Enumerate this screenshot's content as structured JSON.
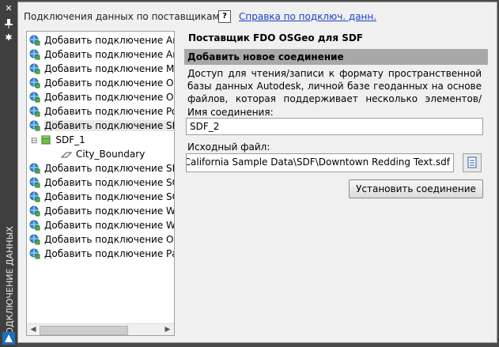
{
  "palette": {
    "vertical_title": "ПОДКЛЮЧЕНИЕ ДАННЫХ",
    "close_icon": "close-icon",
    "pin_icon": "pin-icon",
    "settings_icon": "gear-icon"
  },
  "header": {
    "title": "Подключения данных по поставщикам",
    "help_link": "Справка по подключ. данн."
  },
  "tree": {
    "items": [
      {
        "label": "Добавить подключение ArcGIS",
        "icon": "globe-connection-icon"
      },
      {
        "label": "Добавить подключение ArcSDE",
        "icon": "globe-connection-icon"
      },
      {
        "label": "Добавить подключение MySQL",
        "icon": "globe-connection-icon"
      },
      {
        "label": "Добавить подключение ODBC",
        "icon": "globe-connection-icon"
      },
      {
        "label": "Добавить подключение Oracle",
        "icon": "globe-connection-icon"
      },
      {
        "label": "Добавить подключение PostgreSQL",
        "icon": "globe-connection-icon"
      },
      {
        "label": "Добавить подключение SDF",
        "icon": "globe-connection-icon"
      },
      {
        "label": "SDF_1",
        "icon": "data-store-icon"
      },
      {
        "label": "City_Boundary",
        "icon": "polygon-layer-icon"
      },
      {
        "label": "Добавить подключение SHP",
        "icon": "globe-connection-icon"
      },
      {
        "label": "Добавить подключение SQL Server",
        "icon": "globe-connection-icon"
      },
      {
        "label": "Добавить подключение SQLite",
        "icon": "globe-connection-icon"
      },
      {
        "label": "Добавить подключение WFS",
        "icon": "globe-connection-icon"
      },
      {
        "label": "Добавить подключение WMS",
        "icon": "globe-connection-icon"
      },
      {
        "label": "Добавить подключение Отрисовка",
        "icon": "globe-connection-icon"
      },
      {
        "label": "Добавить подключение Растр",
        "icon": "globe-connection-icon"
      }
    ]
  },
  "form": {
    "provider_title": "Поставщик FDO OSGeo для SDF",
    "section_title": "Добавить новое соединение",
    "description": "Доступ для чтения/записи к формату пространственной базы данных Autodesk, личной базе геоданных на основе файлов, которая поддерживает несколько элементов/атрибутов, простра",
    "name_label": "Имя соединения:",
    "name_value": "SDF_2",
    "file_label": "Исходный файл:",
    "file_value": "dding, California Sample Data\\SDF\\Downtown Redding Text.sdf",
    "connect_button": "Установить соединение"
  }
}
